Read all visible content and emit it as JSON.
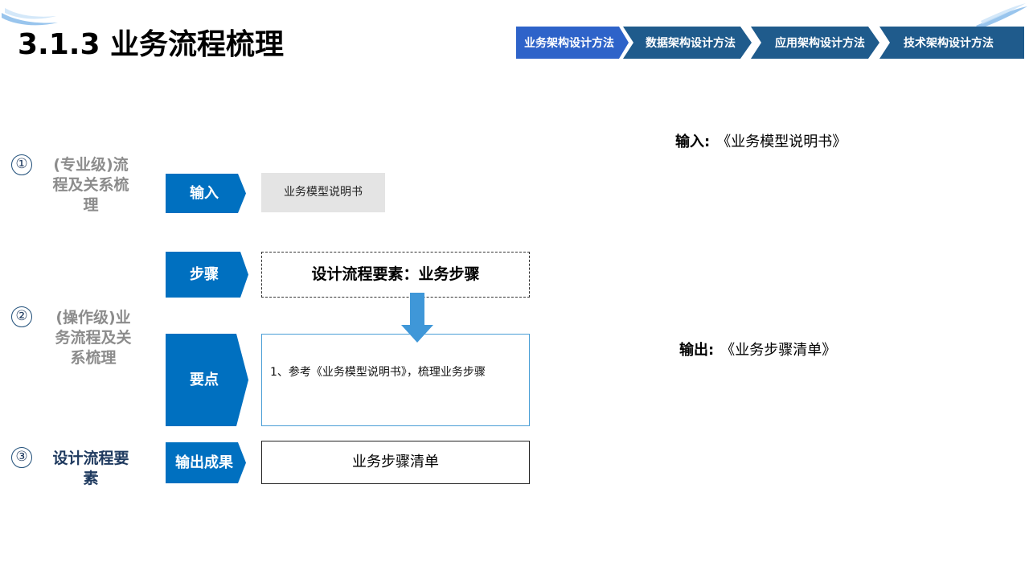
{
  "page": {
    "title": "3.1.3 业务流程梳理"
  },
  "nav": {
    "steps": [
      {
        "label": "业务架构设计方法",
        "active": true
      },
      {
        "label": "数据架构设计方法",
        "active": false
      },
      {
        "label": "应用架构设计方法",
        "active": false
      },
      {
        "label": "技术架构设计方法",
        "active": false
      }
    ]
  },
  "levels": [
    {
      "number": "①",
      "label_line1": "(专业级)流",
      "label_line2": "程及关系梳",
      "label_line3": "理"
    },
    {
      "number": "②",
      "label_line1": "(操作级)业",
      "label_line2": "务流程及关",
      "label_line3": "系梳理"
    },
    {
      "number": "③",
      "label_line1": "设计流程要",
      "label_line2": "素"
    }
  ],
  "rows": {
    "input": {
      "tag": "输入",
      "content": "业务模型说明书"
    },
    "steps": {
      "tag": "步骤",
      "content": "设计流程要素：业务步骤"
    },
    "points": {
      "tag": "要点",
      "content": "1、参考《业务模型说明书》，梳理业务步骤"
    },
    "output": {
      "tag": "输出成果",
      "content": "业务步骤清单"
    }
  },
  "side": {
    "input_label": "输入:",
    "input_value": "《业务模型说明书》",
    "output_label": "输出:",
    "output_value": "《业务步骤清单》"
  },
  "colors": {
    "accent_blue": "#0070c0",
    "nav_active": "#2e63c9",
    "nav_inactive": "#1f5b8c",
    "arrow_blue": "#3f97d8"
  }
}
